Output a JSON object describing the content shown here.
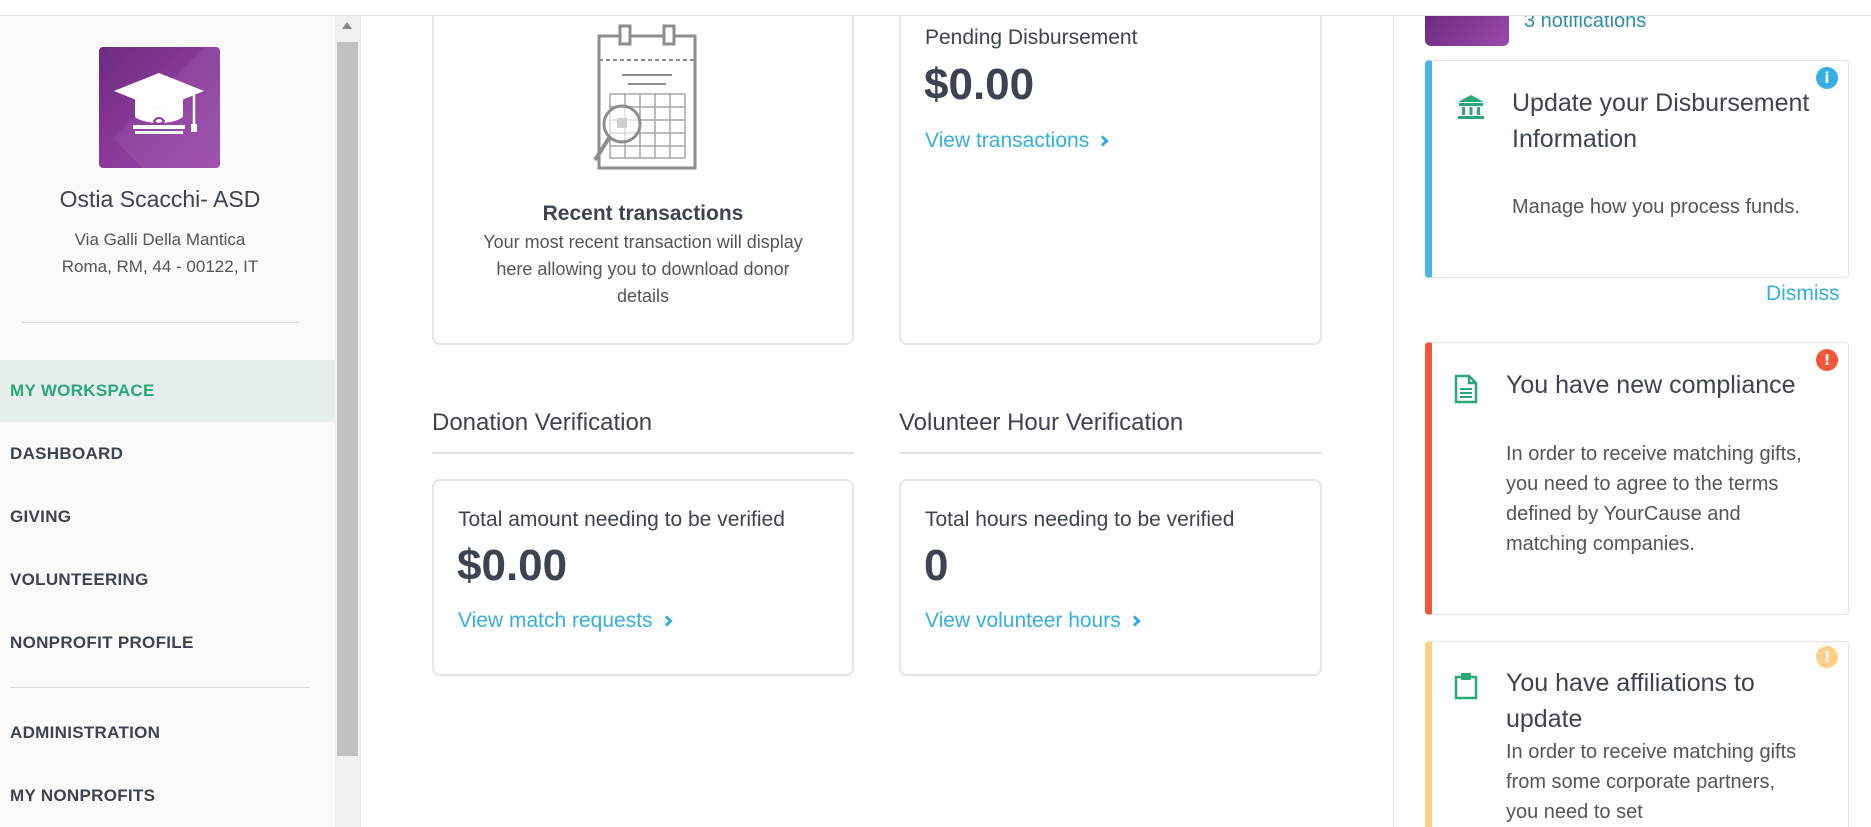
{
  "sidebar": {
    "org_name": "Ostia Scacchi- ASD",
    "address_line1": "Via Galli Della Mantica",
    "address_line2": "Roma, RM, 44 - 00122, IT",
    "nav": [
      {
        "label": "MY WORKSPACE",
        "active": true
      },
      {
        "label": "DASHBOARD"
      },
      {
        "label": "GIVING"
      },
      {
        "label": "VOLUNTEERING"
      },
      {
        "label": "NONPROFIT PROFILE"
      },
      {
        "label": "ADMINISTRATION"
      },
      {
        "label": "MY NONPROFITS"
      }
    ]
  },
  "transactions": {
    "title": "Recent transactions",
    "body": "Your most recent transaction will display here allowing you to download donor details"
  },
  "disbursement": {
    "title": "Pending Disbursement",
    "amount": "$0.00",
    "link": "View transactions"
  },
  "donation_verification": {
    "section": "Donation Verification",
    "title": "Total amount needing to be verified",
    "amount": "$0.00",
    "link": "View match requests"
  },
  "volunteer_verification": {
    "section": "Volunteer Hour Verification",
    "title": "Total hours needing to be verified",
    "amount": "0",
    "link": "View volunteer hours"
  },
  "notifications": {
    "count_label": "3 notifications",
    "dismiss": "Dismiss",
    "items": [
      {
        "title": "Update your Disbursement Information",
        "body": "Manage how you process funds.",
        "accent": "#4bb4e3",
        "icon": "bank-icon",
        "badge": "info-icon"
      },
      {
        "title": "You have new compliance",
        "body": "In order to receive matching gifts, you need to agree to the terms defined by YourCause and matching companies.",
        "accent": "#f4563b",
        "icon": "document-icon",
        "badge": "alert-icon"
      },
      {
        "title": "You have affiliations to update",
        "body": "In order to receive matching gifts from some corporate partners, you need to set",
        "accent": "#fdd08a",
        "icon": "clipboard-icon",
        "badge": "warning-icon"
      }
    ]
  },
  "colors": {
    "accent_green": "#2aa876",
    "link_blue": "#35aee2",
    "logo_purple": "#8a3a9a"
  }
}
